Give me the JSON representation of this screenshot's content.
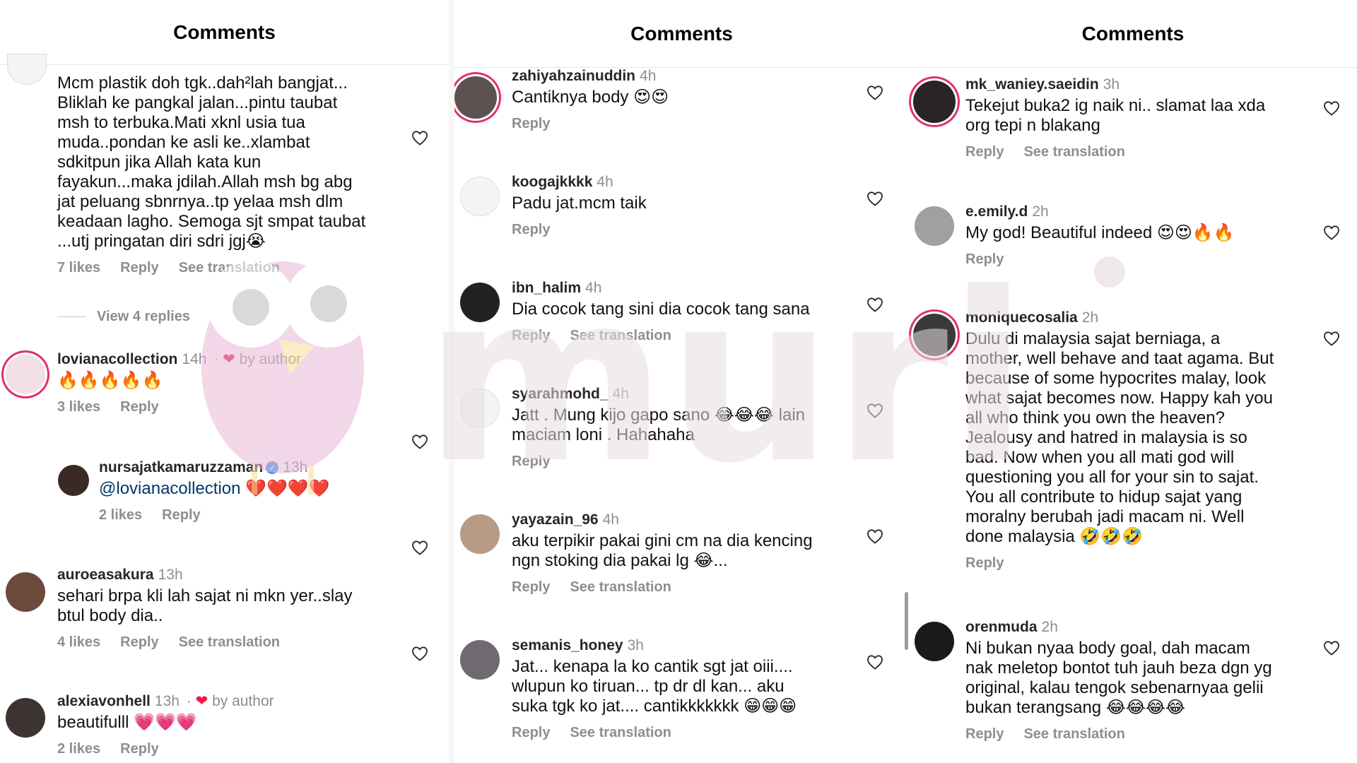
{
  "panels": [
    {
      "title": "Comments",
      "view_replies": "View 4 replies",
      "comments": [
        {
          "username": "",
          "time": "",
          "text": "Mcm plastik doh tgk..dah²lah bangjat...\nBliklah ke pangkal jalan...pintu taubat\nmsh to terbuka.Mati xknl usia tua\nmuda..pondan ke asli ke..xlambat\nsdkitpun jika Allah kata kun\nfayakun...maka jdilah.Allah msh bg abg\njat peluang sbnrnya..tp yelaa msh dlm\nkeadaan lagho. Semoga sjt smpat taubat\n...utj pringatan diri sdri jgj😭",
          "likes": "7 likes",
          "reply": "Reply",
          "translate": "See translation"
        },
        {
          "username": "lovianacollection",
          "time": "14h",
          "author_tag": "by author",
          "text": "🔥🔥🔥🔥🔥",
          "likes": "3 likes",
          "reply": "Reply"
        },
        {
          "username": "nursajatkamaruzzaman",
          "time": "13h",
          "mention": "@lovianacollection",
          "text": " ❤️❤️❤️❤️",
          "likes": "2 likes",
          "reply": "Reply"
        },
        {
          "username": "auroeasakura",
          "time": "13h",
          "text": "sehari brpa kli lah sajat ni mkn yer..slay\nbtul body dia..",
          "likes": "4 likes",
          "reply": "Reply",
          "translate": "See translation"
        },
        {
          "username": "alexiavonhell",
          "time": "13h",
          "author_tag": "by author",
          "text": "beautifulll 💗💗💗",
          "likes": "2 likes",
          "reply": "Reply"
        }
      ]
    },
    {
      "title": "Comments",
      "comments": [
        {
          "username": "zahiyahzainuddin",
          "time": "4h",
          "text": "Cantiknya body 😍😍",
          "reply": "Reply"
        },
        {
          "username": "koogajkkkk",
          "time": "4h",
          "text": "Padu jat.mcm taik",
          "reply": "Reply"
        },
        {
          "username": "ibn_halim",
          "time": "4h",
          "text": "Dia cocok tang sini dia cocok tang sana",
          "reply": "Reply",
          "translate": "See translation"
        },
        {
          "username": "syarahmohd_",
          "time": "4h",
          "text": "Jatt . Mung kijo gapo sano 😂😂😂 lain\nmaciam loni . Hahahaha",
          "reply": "Reply"
        },
        {
          "username": "yayazain_96",
          "time": "4h",
          "text": "aku terpikir pakai gini cm na dia kencing\nngn stoking dia pakai lg 😂...",
          "reply": "Reply",
          "translate": "See translation"
        },
        {
          "username": "semanis_honey",
          "time": "3h",
          "text": "Jat... kenapa la ko cantik sgt jat oiii....\nwlupun ko tiruan... tp dr dl kan... aku\nsuka tgk ko jat.... cantikkkkkkk 😁😁😁",
          "reply": "Reply",
          "translate": "See translation"
        }
      ]
    },
    {
      "title": "Comments",
      "comments": [
        {
          "username": "mk_waniey.saeidin",
          "time": "3h",
          "text": "Tekejut buka2 ig naik ni.. slamat laa xda\norg tepi n blakang",
          "reply": "Reply",
          "translate": "See translation"
        },
        {
          "username": "e.emily.d",
          "time": "2h",
          "text": "My god! Beautiful indeed 😍😍🔥🔥",
          "reply": "Reply"
        },
        {
          "username": "moniquecosalia",
          "time": "2h",
          "text": "Dulu di malaysia sajat berniaga, a\nmother, well behave and taat agama. But\nbecause of some hypocrites malay, look\nwhat sajat becomes now. Happy kah you\nall who think you own the heaven?\nJealousy and hatred in malaysia is so\nbad. Now when you all mati god will\nquestioning you all for your sin to sajat.\nYou all contribute to hidup sajat yang\nmoralny berubah jadi macam ni. Well\ndone malaysia 🤣🤣🤣",
          "reply": "Reply"
        },
        {
          "username": "orenmuda",
          "time": "2h",
          "text": "Ni bukan nyaa body goal, dah macam\nnak meletop bontot tuh jauh beza dgn yg\noriginal, kalau tengok sebenarnyaa gelii\nbukan terangsang 😂😂😂😂",
          "reply": "Reply",
          "translate": "See translation"
        }
      ]
    }
  ],
  "watermark_text": "muri",
  "colors": {
    "accent_red": "#ed1c40",
    "link": "#00376b",
    "muted": "#8e8e8e",
    "ring": "#e1306c",
    "watermark": "#e9dde4"
  }
}
